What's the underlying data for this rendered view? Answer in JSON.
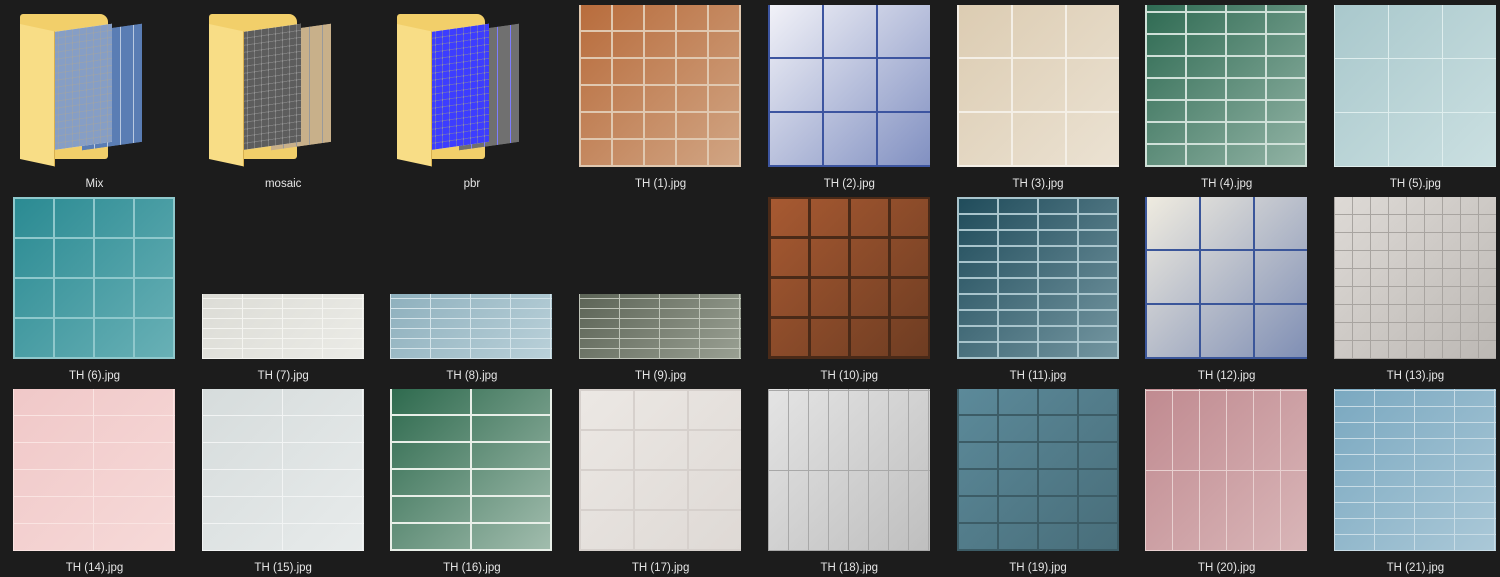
{
  "items": [
    {
      "label": "Mix",
      "type": "folder",
      "colors": [
        "#b9c9e0",
        "#5a7db4"
      ]
    },
    {
      "label": "mosaic",
      "type": "folder",
      "colors": [
        "#9a9a9a",
        "#c8b08a"
      ]
    },
    {
      "label": "pbr",
      "type": "folder",
      "colors": [
        "#7d7dff",
        "#707070"
      ]
    },
    {
      "label": "TH (1).jpg",
      "type": "image",
      "colors": [
        "#b86c3c",
        "#e0c8b0"
      ]
    },
    {
      "label": "TH (2).jpg",
      "type": "image",
      "colors": [
        "#f2f2f8",
        "#3d55a0"
      ]
    },
    {
      "label": "TH (3).jpg",
      "type": "image",
      "colors": [
        "#dcccb2",
        "#f4efe6"
      ]
    },
    {
      "label": "TH (4).jpg",
      "type": "image",
      "colors": [
        "#2e6a52",
        "#cfe0d8"
      ]
    },
    {
      "label": "TH (5).jpg",
      "type": "image",
      "colors": [
        "#a9c8cc",
        "#dfeeee"
      ]
    },
    {
      "label": "TH (6).jpg",
      "type": "image",
      "colors": [
        "#2a8a92",
        "#8fc8cc"
      ]
    },
    {
      "label": "TH (7).jpg",
      "type": "image",
      "colors": [
        "#dcdcd6",
        "#f4f4f0"
      ]
    },
    {
      "label": "TH (8).jpg",
      "type": "image",
      "colors": [
        "#8eb0bd",
        "#d4e4ea"
      ]
    },
    {
      "label": "TH (9).jpg",
      "type": "image",
      "colors": [
        "#5c6456",
        "#bfc4b8"
      ]
    },
    {
      "label": "TH (10).jpg",
      "type": "image",
      "colors": [
        "#a85a32",
        "#4a2a18"
      ]
    },
    {
      "label": "TH (11).jpg",
      "type": "image",
      "colors": [
        "#1f4b5a",
        "#a8c4cc"
      ]
    },
    {
      "label": "TH (12).jpg",
      "type": "image",
      "colors": [
        "#f0ece0",
        "#3b569a"
      ]
    },
    {
      "label": "TH (13).jpg",
      "type": "image",
      "colors": [
        "#dedad6",
        "#a8a4a0"
      ]
    },
    {
      "label": "TH (14).jpg",
      "type": "image",
      "colors": [
        "#f0c8c8",
        "#fae4e2"
      ]
    },
    {
      "label": "TH (15).jpg",
      "type": "image",
      "colors": [
        "#d6dcdc",
        "#f2f4f4"
      ]
    },
    {
      "label": "TH (16).jpg",
      "type": "image",
      "colors": [
        "#2e6a4e",
        "#e8efe8"
      ]
    },
    {
      "label": "TH (17).jpg",
      "type": "image",
      "colors": [
        "#ece8e4",
        "#d6d0cc"
      ]
    },
    {
      "label": "TH (18).jpg",
      "type": "image",
      "colors": [
        "#e4e4e4",
        "#a8a8a8"
      ]
    },
    {
      "label": "TH (19).jpg",
      "type": "image",
      "colors": [
        "#5c8a9a",
        "#3c5c66"
      ]
    },
    {
      "label": "TH (20).jpg",
      "type": "image",
      "colors": [
        "#c08a90",
        "#e8d0d0"
      ]
    },
    {
      "label": "TH (21).jpg",
      "type": "image",
      "colors": [
        "#7aa8c0",
        "#c8dce6"
      ]
    }
  ]
}
